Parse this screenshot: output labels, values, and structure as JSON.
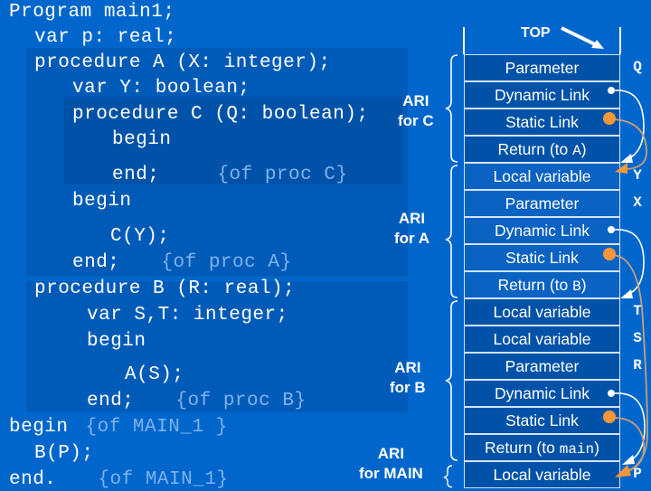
{
  "code": {
    "lines": [
      {
        "text": "Program main1;",
        "comment": ""
      },
      {
        "text": "var p: real;",
        "comment": ""
      },
      {
        "text": "procedure A (X: integer);",
        "comment": ""
      },
      {
        "text": "var Y: boolean;",
        "comment": ""
      },
      {
        "text": "procedure C (Q: boolean);",
        "comment": ""
      },
      {
        "text": "begin",
        "comment": ""
      },
      {
        "text": "end;",
        "comment": "{of proc C}"
      },
      {
        "text": "begin",
        "comment": ""
      },
      {
        "text": "C(Y);",
        "comment": ""
      },
      {
        "text": "end;",
        "comment": "{of proc A}"
      },
      {
        "text": "procedure B (R: real);",
        "comment": ""
      },
      {
        "text": "var S,T: integer;",
        "comment": ""
      },
      {
        "text": "begin",
        "comment": ""
      },
      {
        "text": "A(S);",
        "comment": ""
      },
      {
        "text": "end;",
        "comment": "{of proc B}"
      },
      {
        "text": "begin",
        "comment": "{of MAIN_1 }"
      },
      {
        "text": "B(P);",
        "comment": ""
      },
      {
        "text": "end.",
        "comment": "{of MAIN_1}"
      }
    ]
  },
  "ari_labels": {
    "c": {
      "line1": "ARI",
      "line2": "for C"
    },
    "a": {
      "line1": "ARI",
      "line2": "for A"
    },
    "b": {
      "line1": "ARI",
      "line2": "for B"
    },
    "main": {
      "line1": "ARI",
      "line2": "for MAIN"
    }
  },
  "stack": {
    "top_label": "TOP",
    "rows": [
      {
        "label": "Parameter",
        "arg": "",
        "var": "Q",
        "frame": "C"
      },
      {
        "label": "Dynamic Link",
        "arg": "",
        "var": "",
        "frame": "C"
      },
      {
        "label": "Static Link",
        "arg": "",
        "var": "",
        "frame": "C"
      },
      {
        "label": "Return (to ",
        "arg": "A",
        "var": "",
        "frame": "C"
      },
      {
        "label": "Local variable",
        "arg": "",
        "var": "Y",
        "frame": "A"
      },
      {
        "label": "Parameter",
        "arg": "",
        "var": "X",
        "frame": "A"
      },
      {
        "label": "Dynamic Link",
        "arg": "",
        "var": "",
        "frame": "A"
      },
      {
        "label": "Static Link",
        "arg": "",
        "var": "",
        "frame": "A"
      },
      {
        "label": "Return (to ",
        "arg": "B",
        "var": "",
        "frame": "A"
      },
      {
        "label": "Local variable",
        "arg": "",
        "var": "T",
        "frame": "B"
      },
      {
        "label": "Local variable",
        "arg": "",
        "var": "S",
        "frame": "B"
      },
      {
        "label": "Parameter",
        "arg": "",
        "var": "R",
        "frame": "B"
      },
      {
        "label": "Dynamic Link",
        "arg": "",
        "var": "",
        "frame": "B"
      },
      {
        "label": "Static Link",
        "arg": "",
        "var": "",
        "frame": "B"
      },
      {
        "label": "Return (to ",
        "arg": "main",
        "var": "",
        "frame": "B"
      },
      {
        "label": "Local variable",
        "arg": "",
        "var": "P",
        "frame": "MAIN"
      }
    ]
  },
  "colors": {
    "background": "#0066cc",
    "dynamic_link": "#ffffff",
    "static_link_dot": "#f7963a",
    "static_link_line": "#c8a07a"
  }
}
